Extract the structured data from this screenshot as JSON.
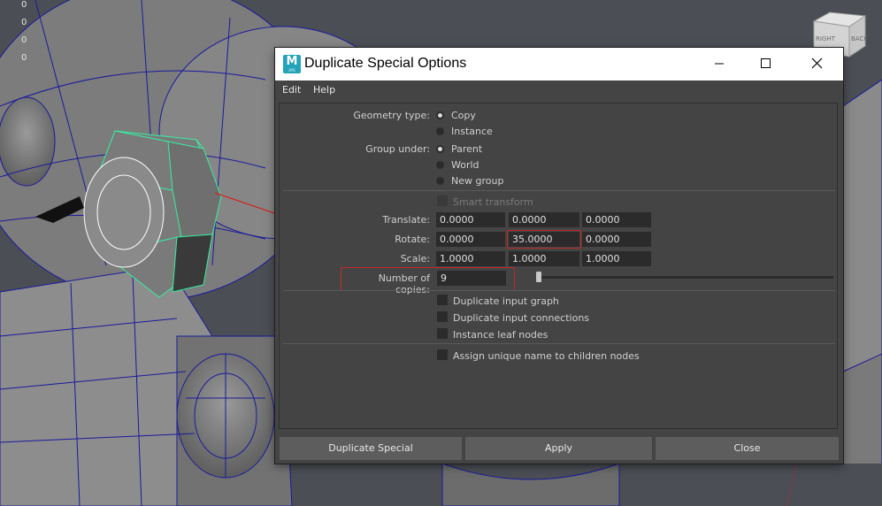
{
  "viewport": {
    "hud_values": [
      "0",
      "0",
      "0",
      "0"
    ],
    "viewcube": {
      "right_label": "RIGHT",
      "back_label": "BACK"
    }
  },
  "dialog": {
    "title": "Duplicate Special Options",
    "app_icon": {
      "letter": "M",
      "sub": "AYS"
    },
    "menu": [
      "Edit",
      "Help"
    ],
    "geometry_type": {
      "label": "Geometry type:",
      "options": [
        "Copy",
        "Instance"
      ],
      "selected": "Copy"
    },
    "group_under": {
      "label": "Group under:",
      "options": [
        "Parent",
        "World",
        "New group"
      ],
      "selected": "Parent"
    },
    "smart_transform": {
      "label": "Smart transform",
      "checked": false,
      "disabled": true
    },
    "translate": {
      "label": "Translate:",
      "values": [
        "0.0000",
        "0.0000",
        "0.0000"
      ]
    },
    "rotate": {
      "label": "Rotate:",
      "values": [
        "0.0000",
        "35.0000",
        "0.0000"
      ]
    },
    "scale": {
      "label": "Scale:",
      "values": [
        "1.0000",
        "1.0000",
        "1.0000"
      ]
    },
    "copies": {
      "label": "Number of copies:",
      "value": "9"
    },
    "checkboxes": [
      "Duplicate input graph",
      "Duplicate input connections",
      "Instance leaf nodes",
      "Assign unique name to children nodes"
    ],
    "buttons": {
      "duplicate": "Duplicate Special",
      "apply": "Apply",
      "close": "Close"
    },
    "colors": {
      "highlight": "#c0282a",
      "selection": "#35f0a0",
      "wire": "#1a1a9c",
      "title_bar": "#ffffff",
      "panel": "#444444"
    }
  }
}
